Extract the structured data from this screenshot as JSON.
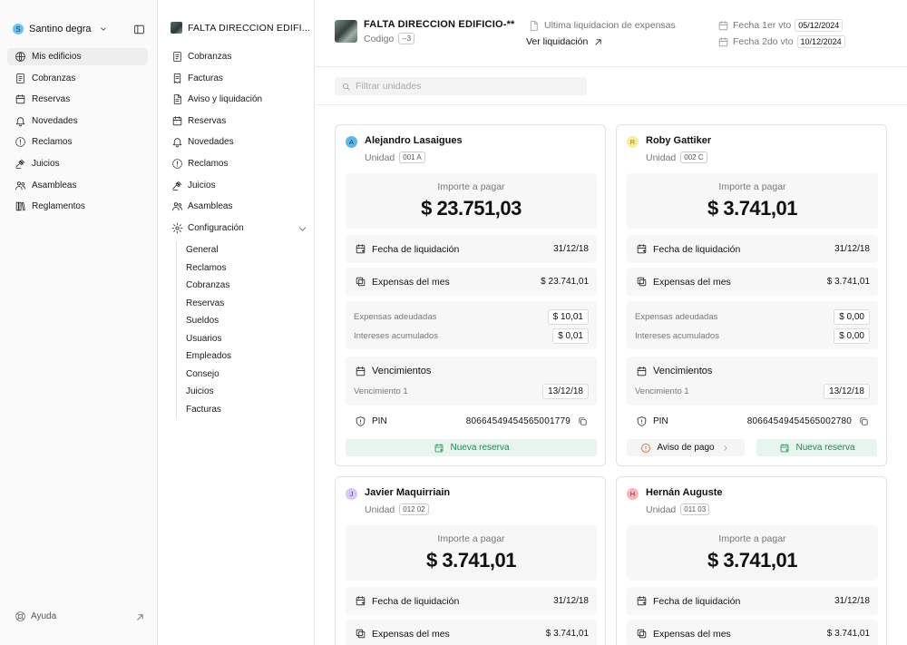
{
  "user": {
    "initial": "S",
    "name": "Santino degra"
  },
  "sidebar": {
    "items": [
      {
        "label": "Mis edificios",
        "icon": "globe-icon"
      },
      {
        "label": "Cobranzas",
        "icon": "receipt-icon"
      },
      {
        "label": "Reservas",
        "icon": "calendar-icon"
      },
      {
        "label": "Novedades",
        "icon": "bell-icon"
      },
      {
        "label": "Reclamos",
        "icon": "alert-circle-icon"
      },
      {
        "label": "Juicios",
        "icon": "gavel-icon"
      },
      {
        "label": "Asambleas",
        "icon": "users-icon"
      },
      {
        "label": "Reglamentos",
        "icon": "books-icon"
      }
    ],
    "help_label": "Ayuda"
  },
  "building_nav": {
    "title": "FALTA DIRECCION EDIFI...",
    "items": [
      {
        "label": "Cobranzas",
        "icon": "receipt-icon"
      },
      {
        "label": "Facturas",
        "icon": "invoice-icon"
      },
      {
        "label": "Aviso y liquidación",
        "icon": "file-text-icon"
      },
      {
        "label": "Reservas",
        "icon": "calendar-icon"
      },
      {
        "label": "Novedades",
        "icon": "bell-icon"
      },
      {
        "label": "Reclamos",
        "icon": "alert-circle-icon"
      },
      {
        "label": "Juicios",
        "icon": "gavel-icon"
      },
      {
        "label": "Asambleas",
        "icon": "users-icon"
      },
      {
        "label": "Configuración",
        "icon": "gear-icon"
      }
    ],
    "config_sub": [
      "General",
      "Reclamos",
      "Cobranzas",
      "Reservas",
      "Sueldos",
      "Usuarios",
      "Empleados",
      "Consejo",
      "Juicios",
      "Facturas"
    ]
  },
  "header": {
    "title": "FALTA DIRECCION EDIFICIO-**",
    "code_label": "Codigo",
    "code_value": "--3",
    "liq_label": "Ultima liquidacion de expensas",
    "liq_link": "Ver liquidación",
    "vto1_label": "Fecha 1er vto",
    "vto1_value": "05/12/2024",
    "vto2_label": "Fecha 2do vto",
    "vto2_value": "10/12/2024"
  },
  "filter": {
    "placeholder": "Filtrar unidades"
  },
  "labels": {
    "importe": "Importe a pagar",
    "fecha_liq": "Fecha de liquidación",
    "expensas_mes": "Expensas del mes",
    "adeudadas": "Expensas adeudadas",
    "intereses": "Intereses acumulados",
    "vencimientos": "Vencimientos",
    "venc1": "Vencimiento 1",
    "pin": "PIN",
    "unidad": "Unidad",
    "nueva_reserva": "Nueva reserva",
    "aviso_pago": "Aviso de pago"
  },
  "units": [
    {
      "initial": "A",
      "avatar_color": "#5ab8ee",
      "avatar_text": "#0d3a57",
      "name": "Alejandro Lasaigues",
      "unit": "001 A",
      "importe": "$ 23.751,03",
      "fecha_liq": "31/12/18",
      "expensas_mes": "$ 23.741,01",
      "adeudadas": "$ 10,01",
      "intereses": "$ 0,01",
      "venc1": "13/12/18",
      "pin": "80664549454565001779"
    },
    {
      "initial": "R",
      "avatar_color": "#f9ee9c",
      "avatar_text": "#8a7a10",
      "name": "Roby Gattiker",
      "unit": "002 C",
      "importe": "$ 3.741,01",
      "fecha_liq": "31/12/18",
      "expensas_mes": "$ 3.741,01",
      "adeudadas": "$ 0,00",
      "intereses": "$ 0,00",
      "venc1": "13/12/18",
      "pin": "80664549454565002780"
    },
    {
      "initial": "J",
      "avatar_color": "#d8c8f4",
      "avatar_text": "#5a3e99",
      "name": "Javier Maquirriain",
      "unit": "012 02",
      "importe": "$ 3.741,01",
      "fecha_liq": "31/12/18",
      "expensas_mes": "$ 3.741,01"
    },
    {
      "initial": "H",
      "avatar_color": "#f7b6bd",
      "avatar_text": "#a0202e",
      "name": "Hernán Auguste",
      "unit": "011 03",
      "importe": "$ 3.741,01",
      "fecha_liq": "31/12/18",
      "expensas_mes": "$ 3.741,01"
    }
  ]
}
